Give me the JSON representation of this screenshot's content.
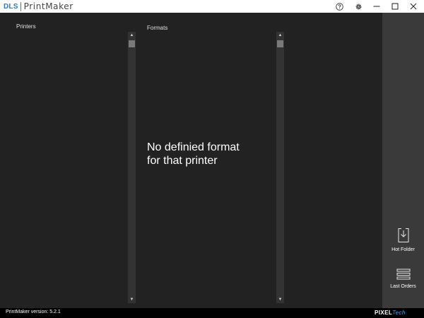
{
  "titlebar": {
    "brand_short": "DLS",
    "app_name": "PrintMaker",
    "help_icon": "help-circle-icon",
    "settings_icon": "gear-icon",
    "minimize_icon": "minimize-icon",
    "maximize_icon": "maximize-icon",
    "close_icon": "close-icon"
  },
  "printers": {
    "title": "Printers"
  },
  "formats": {
    "title": "Formats",
    "empty_message_line1": "No definied format",
    "empty_message_line2": "for that printer"
  },
  "sidebar": {
    "hot_folder_label": "Hot Folder",
    "hot_folder_icon": "download-tray-icon",
    "last_orders_label": "Last Orders",
    "last_orders_icon": "list-icon"
  },
  "statusbar": {
    "version_text": "PrintMaker version: 5.2.1",
    "vendor_pixel": "PIXEL",
    "vendor_tech": "Tech"
  },
  "colors": {
    "background": "#222222",
    "sidebar": "#3a3a3a",
    "accent": "#2a7fc4",
    "statusbar": "#000000"
  }
}
